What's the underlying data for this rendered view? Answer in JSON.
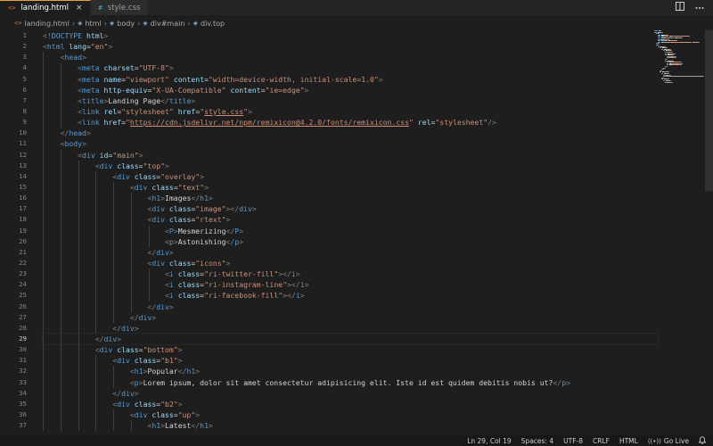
{
  "tabs": [
    {
      "label": "landing.html",
      "icon": "html-file-icon",
      "active": true
    },
    {
      "label": "style.css",
      "icon": "css-file-icon",
      "active": false
    }
  ],
  "tab_icon_glyphs": {
    "html": "<>",
    "css": "#",
    "close": "×"
  },
  "breadcrumb": [
    "landing.html",
    "html",
    "body",
    "div#main",
    "div.top"
  ],
  "current_line": 29,
  "line_numbers": [
    1,
    2,
    3,
    4,
    5,
    6,
    7,
    8,
    9,
    10,
    11,
    12,
    13,
    14,
    15,
    16,
    17,
    18,
    19,
    20,
    21,
    22,
    23,
    24,
    25,
    26,
    27,
    28,
    29,
    30,
    31,
    32,
    33,
    34,
    35,
    36,
    37
  ],
  "code_lines": [
    {
      "i": 0,
      "tokens": [
        [
          "punc",
          "<!"
        ],
        [
          "tag",
          "DOCTYPE"
        ],
        [
          "text",
          " "
        ],
        [
          "attr",
          "html"
        ],
        [
          "punc",
          ">"
        ]
      ]
    },
    {
      "i": 0,
      "tokens": [
        [
          "punc",
          "<"
        ],
        [
          "tag",
          "html"
        ],
        [
          "text",
          " "
        ],
        [
          "attr",
          "lang"
        ],
        [
          "text",
          "="
        ],
        [
          "str",
          "\"en\""
        ],
        [
          "punc",
          ">"
        ]
      ]
    },
    {
      "i": 1,
      "tokens": [
        [
          "punc",
          "<"
        ],
        [
          "tag",
          "head"
        ],
        [
          "punc",
          ">"
        ]
      ]
    },
    {
      "i": 2,
      "tokens": [
        [
          "punc",
          "<"
        ],
        [
          "tag",
          "meta"
        ],
        [
          "text",
          " "
        ],
        [
          "attr",
          "charset"
        ],
        [
          "text",
          "="
        ],
        [
          "str",
          "\"UTF-8\""
        ],
        [
          "punc",
          ">"
        ]
      ]
    },
    {
      "i": 2,
      "tokens": [
        [
          "punc",
          "<"
        ],
        [
          "tag",
          "meta"
        ],
        [
          "text",
          " "
        ],
        [
          "attr",
          "name"
        ],
        [
          "text",
          "="
        ],
        [
          "str",
          "\"viewport\""
        ],
        [
          "text",
          " "
        ],
        [
          "attr",
          "content"
        ],
        [
          "text",
          "="
        ],
        [
          "str",
          "\"width=device-width, initial-scale=1.0\""
        ],
        [
          "punc",
          ">"
        ]
      ]
    },
    {
      "i": 2,
      "tokens": [
        [
          "punc",
          "<"
        ],
        [
          "tag",
          "meta"
        ],
        [
          "text",
          " "
        ],
        [
          "attr",
          "http-equiv"
        ],
        [
          "text",
          "="
        ],
        [
          "str",
          "\"X-UA-Compatible\""
        ],
        [
          "text",
          " "
        ],
        [
          "attr",
          "content"
        ],
        [
          "text",
          "="
        ],
        [
          "str",
          "\"ie=edge\""
        ],
        [
          "punc",
          ">"
        ]
      ]
    },
    {
      "i": 2,
      "tokens": [
        [
          "punc",
          "<"
        ],
        [
          "tag",
          "title"
        ],
        [
          "punc",
          ">"
        ],
        [
          "text",
          "Landing Page"
        ],
        [
          "punc",
          "</"
        ],
        [
          "tag",
          "title"
        ],
        [
          "punc",
          ">"
        ]
      ]
    },
    {
      "i": 2,
      "tokens": [
        [
          "punc",
          "<"
        ],
        [
          "tag",
          "link"
        ],
        [
          "text",
          " "
        ],
        [
          "attr",
          "rel"
        ],
        [
          "text",
          "="
        ],
        [
          "str",
          "\"stylesheet\""
        ],
        [
          "text",
          " "
        ],
        [
          "attr",
          "href"
        ],
        [
          "text",
          "="
        ],
        [
          "str",
          "\""
        ],
        [
          "link",
          "style.css"
        ],
        [
          "str",
          "\""
        ],
        [
          "punc",
          ">"
        ]
      ]
    },
    {
      "i": 2,
      "tokens": [
        [
          "punc",
          "<"
        ],
        [
          "tag",
          "link"
        ],
        [
          "text",
          " "
        ],
        [
          "attr",
          "href"
        ],
        [
          "text",
          "="
        ],
        [
          "str",
          "\""
        ],
        [
          "link",
          "https://cdn.jsdelivr.net/npm/remixicon@4.2.0/fonts/remixicon.css"
        ],
        [
          "str",
          "\""
        ],
        [
          "text",
          " "
        ],
        [
          "attr",
          "rel"
        ],
        [
          "text",
          "="
        ],
        [
          "str",
          "\"stylesheet\""
        ],
        [
          "punc",
          "/>"
        ]
      ]
    },
    {
      "i": 1,
      "tokens": [
        [
          "punc",
          "</"
        ],
        [
          "tag",
          "head"
        ],
        [
          "punc",
          ">"
        ]
      ]
    },
    {
      "i": 1,
      "tokens": [
        [
          "punc",
          "<"
        ],
        [
          "tag",
          "body"
        ],
        [
          "punc",
          ">"
        ]
      ]
    },
    {
      "i": 2,
      "tokens": [
        [
          "punc",
          "<"
        ],
        [
          "tag",
          "div"
        ],
        [
          "text",
          " "
        ],
        [
          "attr",
          "id"
        ],
        [
          "text",
          "="
        ],
        [
          "str",
          "\"main\""
        ],
        [
          "punc",
          ">"
        ]
      ]
    },
    {
      "i": 3,
      "tokens": [
        [
          "punc",
          "<"
        ],
        [
          "tag",
          "div"
        ],
        [
          "text",
          " "
        ],
        [
          "attr",
          "class"
        ],
        [
          "text",
          "="
        ],
        [
          "str",
          "\"top\""
        ],
        [
          "punc",
          ">"
        ]
      ]
    },
    {
      "i": 4,
      "tokens": [
        [
          "punc",
          "<"
        ],
        [
          "tag",
          "div"
        ],
        [
          "text",
          " "
        ],
        [
          "attr",
          "class"
        ],
        [
          "text",
          "="
        ],
        [
          "str",
          "\"overlay\""
        ],
        [
          "punc",
          ">"
        ]
      ]
    },
    {
      "i": 5,
      "tokens": [
        [
          "punc",
          "<"
        ],
        [
          "tag",
          "div"
        ],
        [
          "text",
          " "
        ],
        [
          "attr",
          "class"
        ],
        [
          "text",
          "="
        ],
        [
          "str",
          "\"text\""
        ],
        [
          "punc",
          ">"
        ]
      ]
    },
    {
      "i": 6,
      "tokens": [
        [
          "punc",
          "<"
        ],
        [
          "tag",
          "h1"
        ],
        [
          "punc",
          ">"
        ],
        [
          "text",
          "Images"
        ],
        [
          "punc",
          "</"
        ],
        [
          "tag",
          "h1"
        ],
        [
          "punc",
          ">"
        ]
      ]
    },
    {
      "i": 6,
      "tokens": [
        [
          "punc",
          "<"
        ],
        [
          "tag",
          "div"
        ],
        [
          "text",
          " "
        ],
        [
          "attr",
          "class"
        ],
        [
          "text",
          "="
        ],
        [
          "str",
          "\"image\""
        ],
        [
          "punc",
          "></"
        ],
        [
          "tag",
          "div"
        ],
        [
          "punc",
          ">"
        ]
      ]
    },
    {
      "i": 6,
      "tokens": [
        [
          "punc",
          "<"
        ],
        [
          "tag",
          "div"
        ],
        [
          "text",
          " "
        ],
        [
          "attr",
          "class"
        ],
        [
          "text",
          "="
        ],
        [
          "str",
          "\"rtext\""
        ],
        [
          "punc",
          ">"
        ]
      ]
    },
    {
      "i": 7,
      "tokens": [
        [
          "punc",
          "<"
        ],
        [
          "tag",
          "P"
        ],
        [
          "punc",
          ">"
        ],
        [
          "text",
          "Mesmerizing"
        ],
        [
          "punc",
          "</"
        ],
        [
          "tag",
          "P"
        ],
        [
          "punc",
          ">"
        ]
      ]
    },
    {
      "i": 7,
      "tokens": [
        [
          "punc",
          "<"
        ],
        [
          "tag",
          "p"
        ],
        [
          "punc",
          ">"
        ],
        [
          "text",
          "Astonishing"
        ],
        [
          "punc",
          "</"
        ],
        [
          "tag",
          "p"
        ],
        [
          "punc",
          ">"
        ]
      ]
    },
    {
      "i": 6,
      "tokens": [
        [
          "punc",
          "</"
        ],
        [
          "tag",
          "div"
        ],
        [
          "punc",
          ">"
        ]
      ]
    },
    {
      "i": 6,
      "tokens": [
        [
          "punc",
          "<"
        ],
        [
          "tag",
          "div"
        ],
        [
          "text",
          " "
        ],
        [
          "attr",
          "class"
        ],
        [
          "text",
          "="
        ],
        [
          "str",
          "\"icons\""
        ],
        [
          "punc",
          ">"
        ]
      ]
    },
    {
      "i": 7,
      "tokens": [
        [
          "punc",
          "<"
        ],
        [
          "tag",
          "i"
        ],
        [
          "text",
          " "
        ],
        [
          "attr",
          "class"
        ],
        [
          "text",
          "="
        ],
        [
          "str",
          "\"ri-twitter-fill\""
        ],
        [
          "punc",
          "></"
        ],
        [
          "tag",
          "i"
        ],
        [
          "punc",
          ">"
        ]
      ]
    },
    {
      "i": 7,
      "tokens": [
        [
          "punc",
          "<"
        ],
        [
          "tag",
          "i"
        ],
        [
          "text",
          " "
        ],
        [
          "attr",
          "class"
        ],
        [
          "text",
          "="
        ],
        [
          "str",
          "\"ri-instagram-line\""
        ],
        [
          "punc",
          "></"
        ],
        [
          "tag",
          "i"
        ],
        [
          "punc",
          ">"
        ]
      ]
    },
    {
      "i": 7,
      "tokens": [
        [
          "punc",
          "<"
        ],
        [
          "tag",
          "i"
        ],
        [
          "text",
          " "
        ],
        [
          "attr",
          "class"
        ],
        [
          "text",
          "="
        ],
        [
          "str",
          "\"ri-facebook-fill\""
        ],
        [
          "punc",
          "></"
        ],
        [
          "tag",
          "i"
        ],
        [
          "punc",
          ">"
        ]
      ]
    },
    {
      "i": 6,
      "tokens": [
        [
          "punc",
          "</"
        ],
        [
          "tag",
          "div"
        ],
        [
          "punc",
          ">"
        ]
      ]
    },
    {
      "i": 5,
      "tokens": [
        [
          "punc",
          "</"
        ],
        [
          "tag",
          "div"
        ],
        [
          "punc",
          ">"
        ]
      ]
    },
    {
      "i": 4,
      "tokens": [
        [
          "punc",
          "</"
        ],
        [
          "tag",
          "div"
        ],
        [
          "punc",
          ">"
        ]
      ]
    },
    {
      "i": 3,
      "tokens": [
        [
          "punc",
          "</"
        ],
        [
          "tag",
          "div"
        ],
        [
          "punc",
          ">"
        ]
      ]
    },
    {
      "i": 3,
      "tokens": [
        [
          "punc",
          "<"
        ],
        [
          "tag",
          "div"
        ],
        [
          "text",
          " "
        ],
        [
          "attr",
          "class"
        ],
        [
          "text",
          "="
        ],
        [
          "str",
          "\"bottom\""
        ],
        [
          "punc",
          ">"
        ]
      ]
    },
    {
      "i": 4,
      "tokens": [
        [
          "punc",
          "<"
        ],
        [
          "tag",
          "div"
        ],
        [
          "text",
          " "
        ],
        [
          "attr",
          "class"
        ],
        [
          "text",
          "="
        ],
        [
          "str",
          "\"b1\""
        ],
        [
          "punc",
          ">"
        ]
      ]
    },
    {
      "i": 5,
      "tokens": [
        [
          "punc",
          "<"
        ],
        [
          "tag",
          "h1"
        ],
        [
          "punc",
          ">"
        ],
        [
          "text",
          "Popular"
        ],
        [
          "punc",
          "</"
        ],
        [
          "tag",
          "h1"
        ],
        [
          "punc",
          ">"
        ]
      ]
    },
    {
      "i": 5,
      "tokens": [
        [
          "punc",
          "<"
        ],
        [
          "tag",
          "p"
        ],
        [
          "punc",
          ">"
        ],
        [
          "text",
          "Lorem ipsum, dolor sit amet consectetur adipisicing elit. Iste id est quidem debitis nobis ut?"
        ],
        [
          "punc",
          "</"
        ],
        [
          "tag",
          "p"
        ],
        [
          "punc",
          ">"
        ]
      ]
    },
    {
      "i": 4,
      "tokens": [
        [
          "punc",
          "</"
        ],
        [
          "tag",
          "div"
        ],
        [
          "punc",
          ">"
        ]
      ]
    },
    {
      "i": 4,
      "tokens": [
        [
          "punc",
          "<"
        ],
        [
          "tag",
          "div"
        ],
        [
          "text",
          " "
        ],
        [
          "attr",
          "class"
        ],
        [
          "text",
          "="
        ],
        [
          "str",
          "\"b2\""
        ],
        [
          "punc",
          ">"
        ]
      ]
    },
    {
      "i": 5,
      "tokens": [
        [
          "punc",
          "<"
        ],
        [
          "tag",
          "div"
        ],
        [
          "text",
          " "
        ],
        [
          "attr",
          "class"
        ],
        [
          "text",
          "="
        ],
        [
          "str",
          "\"up\""
        ],
        [
          "punc",
          ">"
        ]
      ]
    },
    {
      "i": 6,
      "tokens": [
        [
          "punc",
          "<"
        ],
        [
          "tag",
          "h1"
        ],
        [
          "punc",
          ">"
        ],
        [
          "text",
          "Latest"
        ],
        [
          "punc",
          "</"
        ],
        [
          "tag",
          "h1"
        ],
        [
          "punc",
          ">"
        ]
      ]
    }
  ],
  "status_bar": {
    "position": "Ln 29, Col 19",
    "spaces": "Spaces: 4",
    "encoding": "UTF-8",
    "eol": "CRLF",
    "language": "HTML",
    "live": "Go Live"
  },
  "colors": {
    "editor_bg": "#1e1e1e",
    "tag": "#569cd6",
    "attr": "#9cdcfe",
    "string": "#ce9178",
    "punctuation": "#808080",
    "active_tab_border": "#e8a33a"
  }
}
